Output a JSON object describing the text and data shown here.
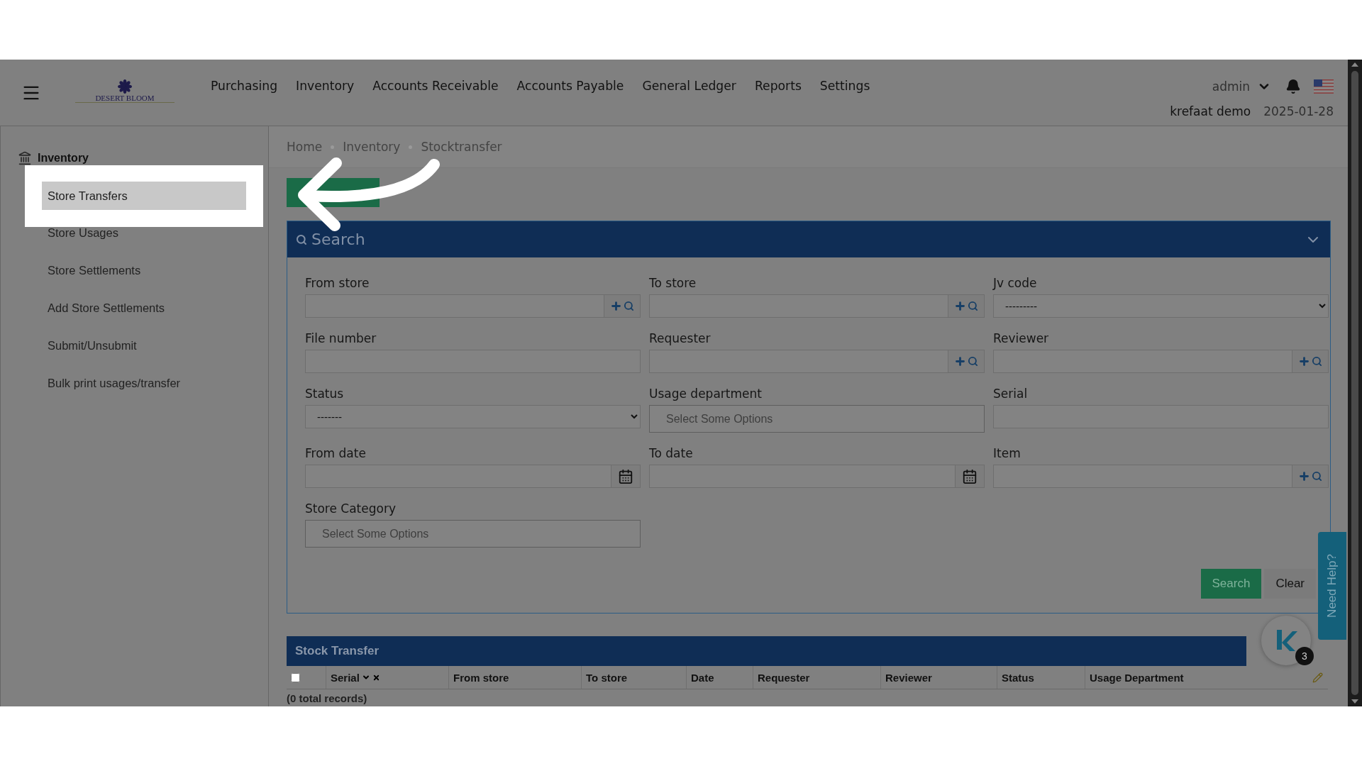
{
  "header": {
    "logo": "DESERT BLOOM",
    "nav": [
      "Purchasing",
      "Inventory",
      "Accounts Receivable",
      "Accounts Payable",
      "General Ledger",
      "Reports",
      "Settings"
    ],
    "user": "admin",
    "company": "krefaat demo",
    "date": "2025-01-28"
  },
  "sidebar": {
    "title": "Inventory",
    "items": [
      {
        "label": "Store Transfers",
        "selected": true
      },
      {
        "label": "Store Usages",
        "selected": false
      },
      {
        "label": "Store Settlements",
        "selected": false
      },
      {
        "label": "Add Store Settlements",
        "selected": false
      },
      {
        "label": "Submit/Unsubmit",
        "selected": false
      },
      {
        "label": "Bulk print usages/transfer",
        "selected": false
      }
    ]
  },
  "breadcrumb": [
    "Home",
    "Inventory",
    "Stocktransfer"
  ],
  "search_panel": {
    "title": "Search",
    "fields": [
      {
        "label": "From store",
        "kind": "lookup"
      },
      {
        "label": "To store",
        "kind": "lookup"
      },
      {
        "label": "Jv code",
        "kind": "select",
        "value": "---------"
      },
      {
        "label": "File number",
        "kind": "text"
      },
      {
        "label": "Requester",
        "kind": "lookup"
      },
      {
        "label": "Reviewer",
        "kind": "lookup"
      },
      {
        "label": "Status",
        "kind": "select",
        "value": "-------"
      },
      {
        "label": "Usage department",
        "kind": "multi",
        "placeholder": "Select Some Options"
      },
      {
        "label": "Serial",
        "kind": "text"
      },
      {
        "label": "From date",
        "kind": "date"
      },
      {
        "label": "To date",
        "kind": "date"
      },
      {
        "label": "Item",
        "kind": "lookup"
      },
      {
        "label": "Store Category",
        "kind": "multi",
        "placeholder": "Select Some Options"
      }
    ],
    "buttons": [
      {
        "label": "Search",
        "kind": "primary"
      },
      {
        "label": "Clear",
        "kind": "plain"
      }
    ]
  },
  "table": {
    "title": "Stock Transfer",
    "columns": [
      "Serial",
      "From store",
      "To store",
      "Date",
      "Requester",
      "Reviewer",
      "Status",
      "Usage Department"
    ],
    "footer": "(0 total records)",
    "select_all": {
      "checked": false
    }
  },
  "help_tab": "Need Help?",
  "chat_badge": "3"
}
